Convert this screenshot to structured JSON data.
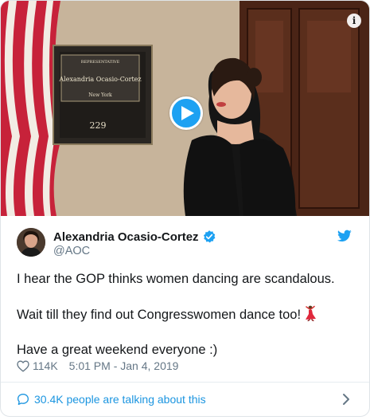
{
  "media": {
    "info_icon": "info-icon",
    "play_icon": "play-icon",
    "plaque": {
      "title": "REPRESENTATIVE",
      "name": "Alexandria Ocasio-Cortez",
      "state": "New York",
      "room": "229"
    }
  },
  "author": {
    "display_name": "Alexandria Ocasio-Cortez",
    "handle": "@AOC",
    "verified_icon": "verified-badge-icon"
  },
  "brand": {
    "icon": "twitter-bird-icon",
    "color": "#1da1f2"
  },
  "tweet": {
    "line1": "I hear the GOP thinks women dancing are scandalous.",
    "line2": "Wait till they find out Congresswomen dance too!",
    "line2_emoji": "dancer-emoji",
    "line3": "Have a great weekend everyone :)"
  },
  "meta": {
    "like_icon": "heart-icon",
    "likes": "114K",
    "timestamp": "5:01 PM - Jan 4, 2019"
  },
  "footer": {
    "icon": "speech-bubble-icon",
    "label": "30.4K people are talking about this",
    "chevron": "chevron-right-icon",
    "link_color": "#1b95e0"
  }
}
